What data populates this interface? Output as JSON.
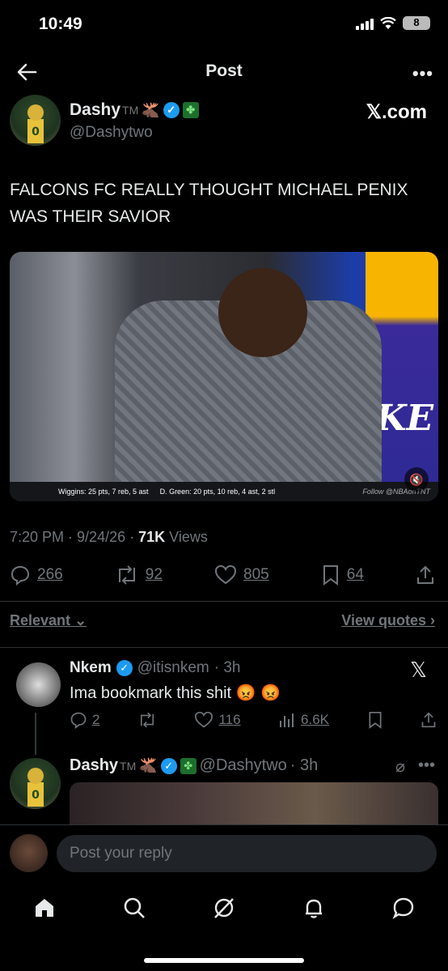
{
  "status_bar": {
    "time": "10:49",
    "battery": "8"
  },
  "header": {
    "title": "Post"
  },
  "post": {
    "author_name": "Dashy",
    "author_tm": "TM",
    "author_handle": "@Dashytwo",
    "brand": "𝕏.com",
    "text": "FALCONS FC REALLY THOUGHT MICHAEL PENIX WAS THEIR SAVIOR",
    "media": {
      "ticker_left": "Wiggins: 25 pts, 7 reb, 5 ast",
      "ticker_right": "D. Green: 20 pts, 10 reb, 4 ast, 2 stl",
      "ticker_follow": "Follow @NBAonTNT",
      "overlay_text": "LAKE"
    },
    "time": "7:20 PM",
    "date": "9/24/26",
    "views_count": "71K",
    "views_label": "Views",
    "stats": {
      "replies": "266",
      "reposts": "92",
      "likes": "805",
      "bookmarks": "64"
    }
  },
  "sort": {
    "relevant": "Relevant",
    "view_quotes": "View quotes"
  },
  "replies": [
    {
      "name": "Nkem",
      "handle": "@itisnkem",
      "time": "· 3h",
      "text": "Ima bookmark this shit 😡 😡",
      "stats": {
        "replies": "2",
        "likes": "116",
        "views": "6.6K"
      }
    },
    {
      "name": "Dashy",
      "tm": "TM",
      "handle": "@Dashytwo",
      "time": "· 3h"
    }
  ],
  "composer": {
    "placeholder": "Post your reply"
  }
}
